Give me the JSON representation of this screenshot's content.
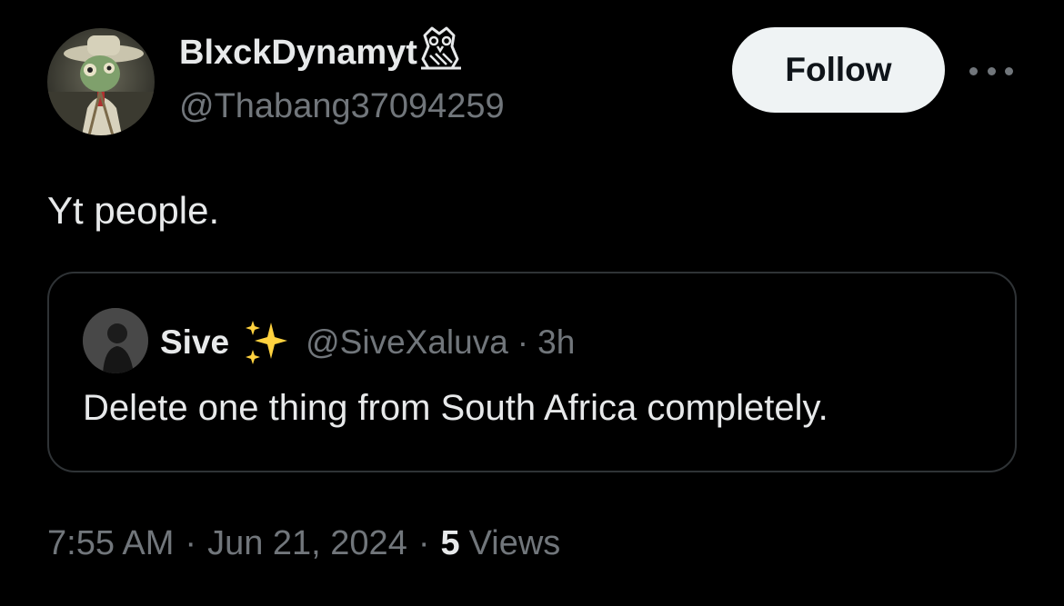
{
  "author": {
    "display_name": "BlxckDynamyt",
    "handle": "@Thabang37094259",
    "avatar": "avatar-image",
    "badge_icon": "owl-icon"
  },
  "follow_button": {
    "label": "Follow"
  },
  "more_button": {
    "icon": "more-horizontal-icon"
  },
  "tweet": {
    "text": "Yt people."
  },
  "quote": {
    "name": "Sive",
    "badge_icon": "sparkles-icon",
    "handle": "@SiveXaluva",
    "dot": "·",
    "time": "3h",
    "text": "Delete one thing from South Africa completely."
  },
  "meta": {
    "time": "7:55 AM",
    "sep": "·",
    "date": "Jun 21, 2024",
    "views_count": "5",
    "views_label": "Views"
  },
  "colors": {
    "background": "#000000",
    "text_primary": "#e7e9ea",
    "text_secondary": "#71767b",
    "border": "#2f3336",
    "button_bg": "#eff3f4",
    "sparkle": "#ffd23f"
  }
}
